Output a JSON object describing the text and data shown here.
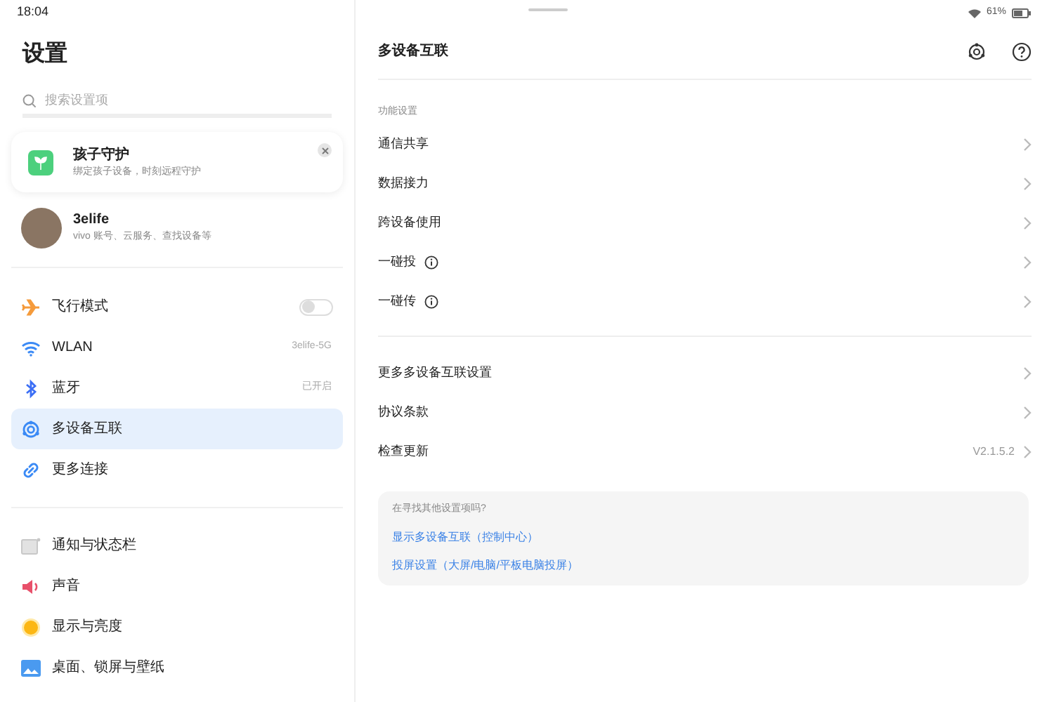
{
  "status_bar": {
    "time": "18:04",
    "battery": "61%"
  },
  "sidebar": {
    "title": "设置",
    "search": {
      "placeholder": "搜索设置项"
    },
    "promo_card": {
      "title": "孩子守护",
      "subtitle": "绑定孩子设备，时刻远程守护"
    },
    "account": {
      "name": "3elife",
      "subtitle": "vivo 账号、云服务、查找设备等"
    },
    "groups": [
      [
        {
          "label": "飞行模式",
          "kind": "toggle",
          "on": false,
          "selected": false
        },
        {
          "label": "WLAN",
          "kind": "value",
          "value": "3elife-5G",
          "selected": false
        },
        {
          "label": "蓝牙",
          "kind": "value",
          "value": "已开启",
          "selected": false
        },
        {
          "label": "多设备互联",
          "kind": "plain",
          "selected": true
        },
        {
          "label": "更多连接",
          "kind": "plain",
          "selected": false
        }
      ],
      [
        {
          "label": "通知与状态栏",
          "kind": "plain",
          "selected": false
        },
        {
          "label": "声音",
          "kind": "plain",
          "selected": false
        },
        {
          "label": "显示与亮度",
          "kind": "plain",
          "selected": false
        },
        {
          "label": "桌面、锁屏与壁纸",
          "kind": "plain",
          "selected": false
        }
      ]
    ]
  },
  "detail": {
    "title": "多设备互联",
    "section_label": "功能设置",
    "groups": [
      [
        {
          "label": "通信共享",
          "info": false
        },
        {
          "label": "数据接力",
          "info": false
        },
        {
          "label": "跨设备使用",
          "info": false
        },
        {
          "label": "一碰投",
          "info": true
        },
        {
          "label": "一碰传",
          "info": true
        }
      ],
      [
        {
          "label": "更多多设备互联设置",
          "info": false
        },
        {
          "label": "协议条款",
          "info": false
        },
        {
          "label": "检查更新",
          "info": false,
          "value": "V2.1.5.2"
        }
      ]
    ],
    "suggestions": {
      "title": "在寻找其他设置项吗?",
      "links": [
        "显示多设备互联（控制中心）",
        "投屏设置（大屏/电脑/平板电脑投屏）"
      ]
    }
  }
}
